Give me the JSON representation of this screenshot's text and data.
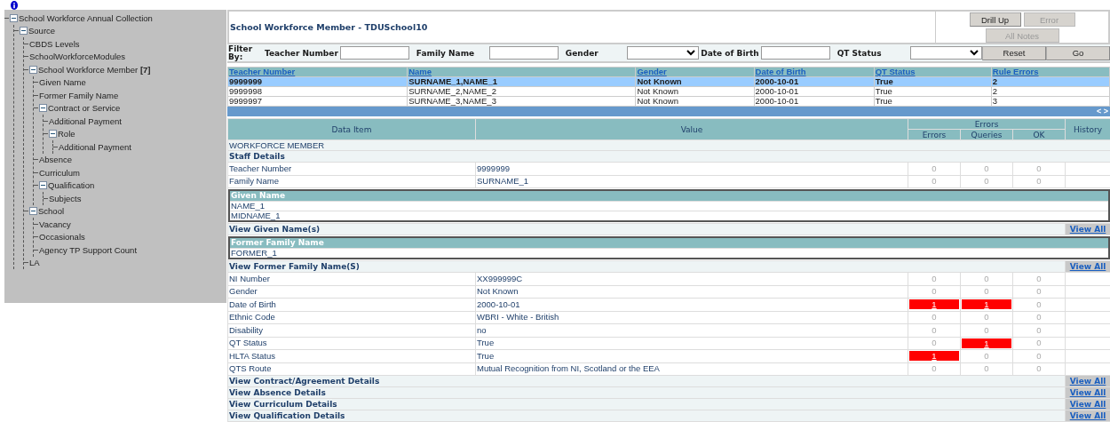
{
  "tree": [
    {
      "label": "School Workforce Annual Collection",
      "expanded": true,
      "children": [
        {
          "label": "Source",
          "expanded": true,
          "children": [
            {
              "label": "CBDS Levels"
            },
            {
              "label": "SchoolWorkforceModules"
            },
            {
              "label": "School Workforce Member **[7]**",
              "expanded": true,
              "children": [
                {
                  "label": "Given Name"
                },
                {
                  "label": "Former Family Name"
                },
                {
                  "label": "Contract or Service",
                  "expanded": true,
                  "children": [
                    {
                      "label": "Additional Payment"
                    },
                    {
                      "label": "Role",
                      "expanded": true,
                      "children": [
                        {
                          "label": "Additional Payment"
                        }
                      ]
                    }
                  ]
                },
                {
                  "label": "Absence"
                },
                {
                  "label": "Curriculum"
                },
                {
                  "label": "Qualification",
                  "expanded": true,
                  "children": [
                    {
                      "label": "Subjects"
                    }
                  ]
                }
              ]
            },
            {
              "label": "School",
              "expanded": true,
              "children": [
                {
                  "label": "Vacancy"
                },
                {
                  "label": "Occasionals"
                },
                {
                  "label": "Agency TP Support Count"
                }
              ]
            },
            {
              "label": "LA"
            }
          ]
        }
      ]
    }
  ],
  "header": {
    "title": "School Workforce Member - TDUSchool10",
    "buttons": [
      {
        "label": "Drill Up",
        "disabled": false
      },
      {
        "label": "Error",
        "disabled": true
      },
      {
        "label": "All Notes",
        "disabled": true
      }
    ]
  },
  "filter": {
    "label": "Filter By:",
    "fields": [
      {
        "kind": "text",
        "label": "Teacher Number"
      },
      {
        "kind": "text",
        "label": "Family Name"
      },
      {
        "kind": "select",
        "label": "Gender"
      },
      {
        "kind": "text",
        "label": "Date of Birth"
      },
      {
        "kind": "select",
        "label": "QT Status"
      }
    ],
    "buttons": [
      "Reset",
      "Go"
    ]
  },
  "members": {
    "columns": [
      "Teacher Number",
      "Name",
      "Gender",
      "Date of Birth",
      "QT Status",
      "Rule Errors"
    ],
    "rows": [
      {
        "selected": true,
        "cells": [
          "9999999",
          "SURNAME_1,NAME_1",
          "Not Known",
          "2000-10-01",
          "True",
          "2"
        ]
      },
      {
        "selected": false,
        "cells": [
          "9999998",
          "SURNAME_2,NAME_2",
          "Not Known",
          "2000-10-01",
          "True",
          "2"
        ]
      },
      {
        "selected": false,
        "cells": [
          "9999997",
          "SURNAME_3,NAME_3",
          "Not Known",
          "2000-10-01",
          "True",
          "3"
        ]
      }
    ],
    "scroll_arrows": "< >"
  },
  "details": {
    "columns": {
      "item": "Data Item",
      "value": "Value",
      "errors_group": "Errors",
      "errors": "Errors",
      "queries": "Queries",
      "ok": "OK",
      "history": "History"
    },
    "rows": [
      {
        "kind": "section",
        "label": "WORKFORCE MEMBER"
      },
      {
        "kind": "group",
        "label": "Staff Details"
      },
      {
        "kind": "field",
        "label": "Teacher Number",
        "value": "9999999",
        "counts": [
          {
            "text": "0",
            "flagged": false
          },
          {
            "text": "0",
            "flagged": false
          },
          {
            "text": "0",
            "flagged": false
          }
        ]
      },
      {
        "kind": "field",
        "label": "Family Name",
        "value": "SURNAME_1",
        "counts": [
          {
            "text": "0",
            "flagged": false
          },
          {
            "text": "0",
            "flagged": false
          },
          {
            "text": "0",
            "flagged": false
          }
        ]
      },
      {
        "kind": "subtable",
        "title": "Given Name",
        "items": [
          "NAME_1",
          "MIDNAME_1"
        ]
      },
      {
        "kind": "view",
        "label": "View Given Name(s)",
        "link": "View All"
      },
      {
        "kind": "subtable",
        "title": "Former Family Name",
        "items": [
          "FORMER_1"
        ]
      },
      {
        "kind": "view",
        "label": "View Former Family Name(S)",
        "link": "View All"
      },
      {
        "kind": "field",
        "label": "NI Number",
        "value": "XX999999C",
        "counts": [
          {
            "text": "0",
            "flagged": false
          },
          {
            "text": "0",
            "flagged": false
          },
          {
            "text": "0",
            "flagged": false
          }
        ]
      },
      {
        "kind": "field",
        "label": "Gender",
        "value": "Not Known",
        "counts": [
          {
            "text": "0",
            "flagged": false
          },
          {
            "text": "0",
            "flagged": false
          },
          {
            "text": "0",
            "flagged": false
          }
        ]
      },
      {
        "kind": "field",
        "label": "Date of Birth",
        "value": "2000-10-01",
        "counts": [
          {
            "text": "1",
            "flagged": true
          },
          {
            "text": "1",
            "flagged": true
          },
          {
            "text": "0",
            "flagged": false
          }
        ]
      },
      {
        "kind": "field",
        "label": "Ethnic Code",
        "value": "WBRI - White - British",
        "counts": [
          {
            "text": "0",
            "flagged": false
          },
          {
            "text": "0",
            "flagged": false
          },
          {
            "text": "0",
            "flagged": false
          }
        ]
      },
      {
        "kind": "field",
        "label": "Disability",
        "value": "no",
        "counts": [
          {
            "text": "0",
            "flagged": false
          },
          {
            "text": "0",
            "flagged": false
          },
          {
            "text": "0",
            "flagged": false
          }
        ]
      },
      {
        "kind": "field",
        "label": "QT Status",
        "value": "True",
        "counts": [
          {
            "text": "0",
            "flagged": false
          },
          {
            "text": "1",
            "flagged": true
          },
          {
            "text": "0",
            "flagged": false
          }
        ]
      },
      {
        "kind": "field",
        "label": "HLTA Status",
        "value": "True",
        "counts": [
          {
            "text": "1",
            "flagged": true
          },
          {
            "text": "0",
            "flagged": false
          },
          {
            "text": "0",
            "flagged": false
          }
        ]
      },
      {
        "kind": "field",
        "label": "QTS Route",
        "value": "Mutual Recognition from NI, Scotland or the EEA",
        "counts": [
          {
            "text": "0",
            "flagged": false
          },
          {
            "text": "0",
            "flagged": false
          },
          {
            "text": "0",
            "flagged": false
          }
        ]
      },
      {
        "kind": "view",
        "label": "View Contract/Agreement Details",
        "link": "View All"
      },
      {
        "kind": "view",
        "label": "View Absence Details",
        "link": "View All"
      },
      {
        "kind": "view",
        "label": "View Curriculum Details",
        "link": "View All"
      },
      {
        "kind": "view",
        "label": "View Qualification Details",
        "link": "View All"
      }
    ]
  }
}
